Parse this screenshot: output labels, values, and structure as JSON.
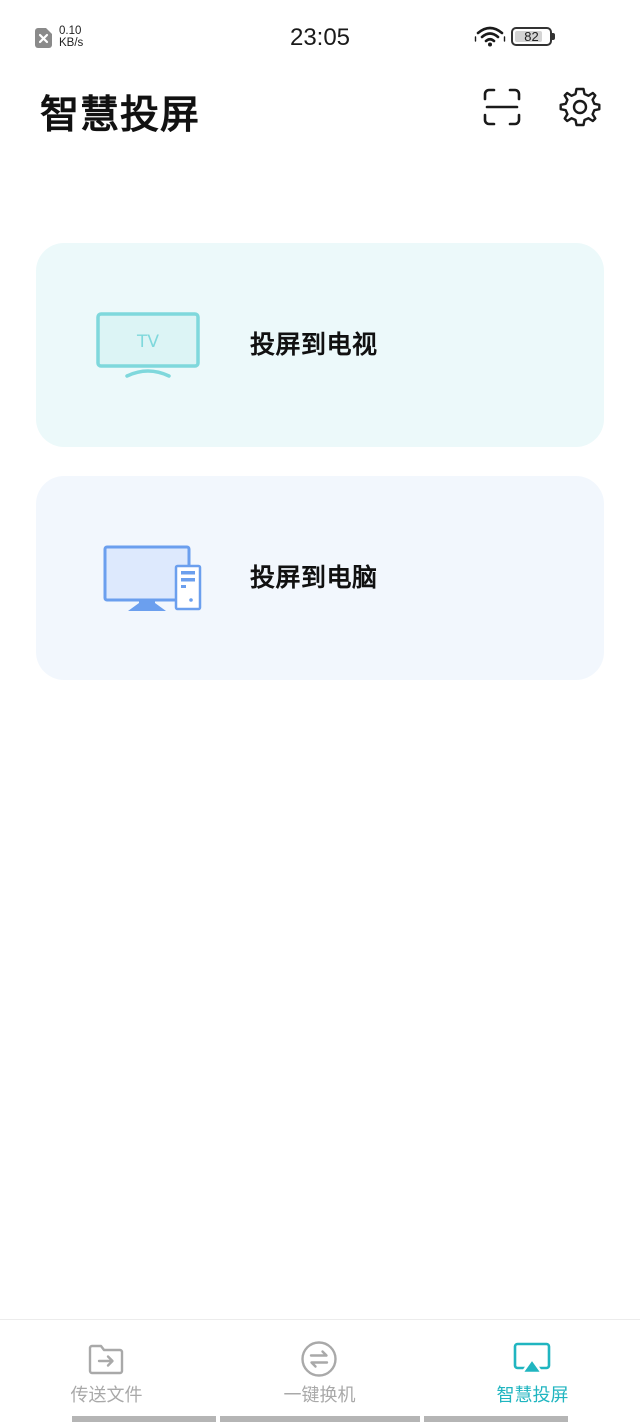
{
  "status_bar": {
    "net_speed_value": "0.10",
    "net_speed_unit": "KB/s",
    "time": "23:05",
    "battery_level": "82",
    "battery_fraction": 0.82
  },
  "header": {
    "title": "智慧投屏",
    "icons": [
      "scan-icon",
      "gear-icon"
    ]
  },
  "cards": [
    {
      "icon": "tv-icon",
      "icon_text": "TV",
      "label": "投屏到电视",
      "bg_color": "#ecf9fa",
      "accent": "#7fd8dc"
    },
    {
      "icon": "computer-icon",
      "label": "投屏到电脑",
      "bg_color": "#f2f7fd",
      "accent": "#6b9fee"
    }
  ],
  "bottom_nav": {
    "items": [
      {
        "icon": "folder-transfer-icon",
        "label": "传送文件",
        "active": false
      },
      {
        "icon": "swap-icon",
        "label": "一键换机",
        "active": false
      },
      {
        "icon": "screen-cast-icon",
        "label": "智慧投屏",
        "active": true
      }
    ],
    "active_color": "#20b5c0",
    "inactive_color": "#a9a9a9"
  }
}
